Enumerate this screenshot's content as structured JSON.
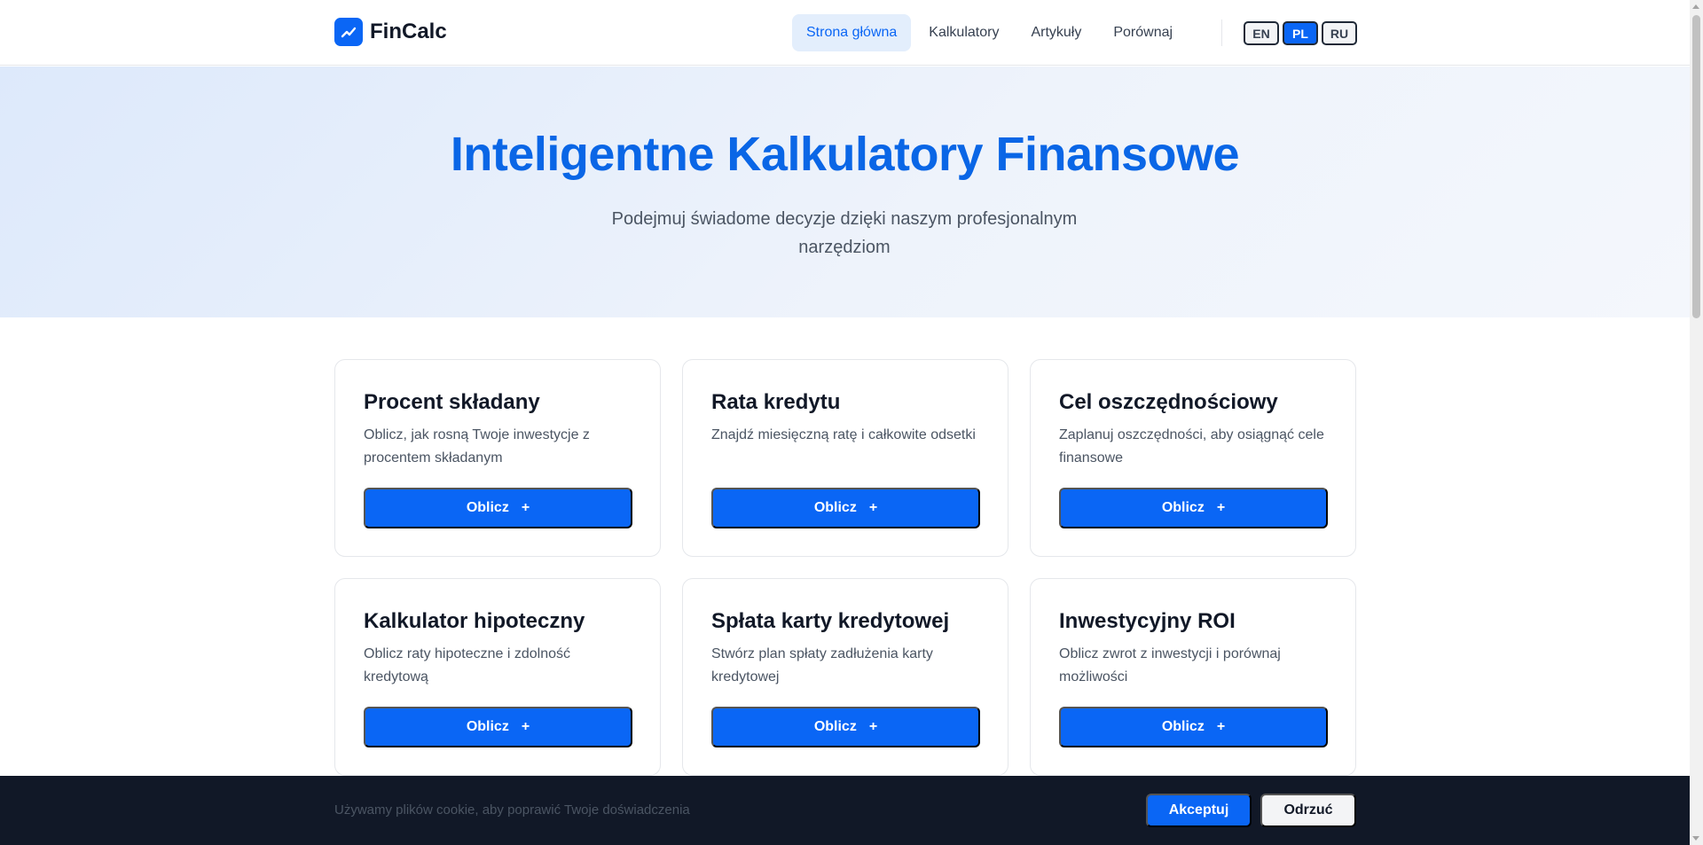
{
  "header": {
    "logo_text": "FinCalc",
    "nav": [
      {
        "label": "Strona główna",
        "active": true
      },
      {
        "label": "Kalkulatory",
        "active": false
      },
      {
        "label": "Artykuły",
        "active": false
      },
      {
        "label": "Porównaj",
        "active": false
      }
    ],
    "languages": [
      {
        "label": "EN",
        "active": false
      },
      {
        "label": "PL",
        "active": true
      },
      {
        "label": "RU",
        "active": false
      }
    ]
  },
  "hero": {
    "title": "Inteligentne Kalkulatory Finansowe",
    "subtitle": "Podejmuj świadome decyzje dzięki naszym profesjonalnym narzędziom"
  },
  "cards": [
    {
      "title": "Procent składany",
      "description": "Oblicz, jak rosną Twoje inwestycje z procentem składanym",
      "button": "Oblicz",
      "button_icon": "+"
    },
    {
      "title": "Rata kredytu",
      "description": "Znajdź miesięczną ratę i całkowite odsetki",
      "button": "Oblicz",
      "button_icon": "+"
    },
    {
      "title": "Cel oszczędnościowy",
      "description": "Zaplanuj oszczędności, aby osiągnąć cele finansowe",
      "button": "Oblicz",
      "button_icon": "+"
    },
    {
      "title": "Kalkulator hipoteczny",
      "description": "Oblicz raty hipoteczne i zdolność kredytową",
      "button": "Oblicz",
      "button_icon": "+"
    },
    {
      "title": "Spłata karty kredytowej",
      "description": "Stwórz plan spłaty zadłużenia karty kredytowej",
      "button": "Oblicz",
      "button_icon": "+"
    },
    {
      "title": "Inwestycyjny ROI",
      "description": "Oblicz zwrot z inwestycji i porównaj możliwości",
      "button": "Oblicz",
      "button_icon": "+"
    }
  ],
  "cookie_bar": {
    "text": "Używamy plików cookie, aby poprawić Twoje doświadczenia",
    "accept": "Akceptuj",
    "reject": "Odrzuć"
  },
  "colors": {
    "accent": "#0a66f5",
    "hero_title": "#0a66e6",
    "cookie_bg": "#111827"
  },
  "icons": {
    "logo": "trending-up-icon",
    "card_button": "plus-icon"
  }
}
